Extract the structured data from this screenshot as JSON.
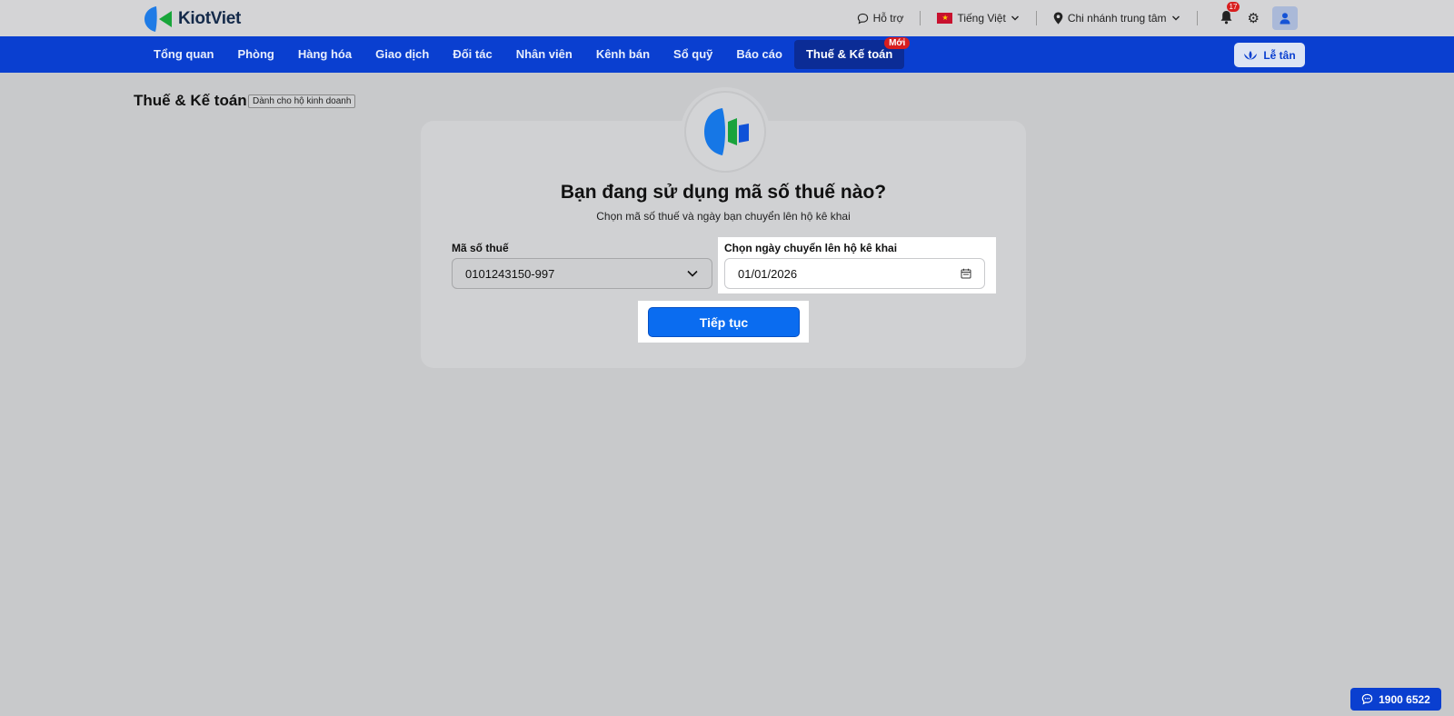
{
  "brand": {
    "name": "KiotViet"
  },
  "topbar": {
    "support": "Hỗ trợ",
    "language": "Tiếng Việt",
    "branch": "Chi nhánh trung tâm",
    "notification_count": "17"
  },
  "nav": {
    "items": [
      "Tổng quan",
      "Phòng",
      "Hàng hóa",
      "Giao dịch",
      "Đối tác",
      "Nhân viên",
      "Kênh bán",
      "Sổ quỹ",
      "Báo cáo",
      "Thuế & Kế toán"
    ],
    "active_index": 9,
    "new_badge": "Mới",
    "reception": "Lễ tân"
  },
  "page": {
    "title": "Thuế & Kế toán",
    "badge": "Dành cho hộ kinh doanh"
  },
  "form": {
    "heading": "Bạn đang sử dụng mã số thuế nào?",
    "subheading": "Chọn mã số thuế và ngày bạn chuyển lên hộ kê khai",
    "tax_label": "Mã số thuế",
    "tax_value": "0101243150-997",
    "date_label": "Chọn ngày chuyển lên hộ kê khai",
    "date_value": "01/01/2026",
    "continue": "Tiếp tục"
  },
  "hotline": "1900 6522",
  "colors": {
    "primary": "#0a3fd0",
    "button": "#0a6cf0",
    "badge": "#d81e1e"
  }
}
